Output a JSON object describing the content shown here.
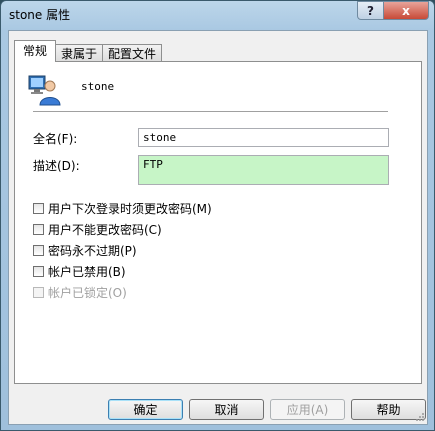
{
  "window": {
    "title": "stone 属性",
    "help_glyph": "?",
    "close_glyph": "x"
  },
  "tabs": [
    {
      "label": "常规",
      "active": true
    },
    {
      "label": "隶属于",
      "active": false
    },
    {
      "label": "配置文件",
      "active": false
    }
  ],
  "user": {
    "display_name": "stone",
    "icon": "user-icon"
  },
  "fields": {
    "full_name_label": "全名(F):",
    "full_name_value": "stone",
    "description_label": "描述(D):",
    "description_value": "FTP"
  },
  "checkboxes": [
    {
      "label": "用户下次登录时须更改密码(M)",
      "checked": false,
      "enabled": true
    },
    {
      "label": "用户不能更改密码(C)",
      "checked": false,
      "enabled": true
    },
    {
      "label": "密码永不过期(P)",
      "checked": false,
      "enabled": true
    },
    {
      "label": "帐户已禁用(B)",
      "checked": false,
      "enabled": true
    },
    {
      "label": "帐户已锁定(O)",
      "checked": false,
      "enabled": false
    }
  ],
  "buttons": {
    "ok": "确定",
    "cancel": "取消",
    "apply": "应用(A)",
    "help": "帮助"
  },
  "colors": {
    "description_bg": "#c7f5c7",
    "close_button": "#c84a37"
  }
}
